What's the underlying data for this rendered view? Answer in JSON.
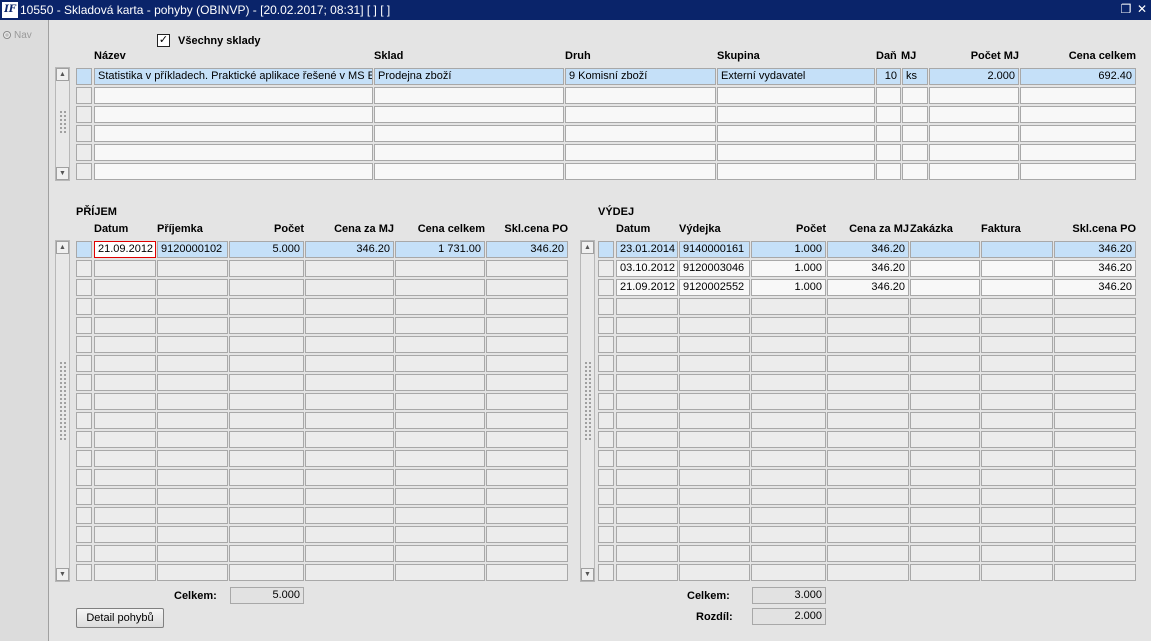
{
  "window": {
    "title": "10550 - Skladová karta - pohyby (OBINVP) - [20.02.2017; 08:31] [ ] [ ]",
    "icon_text": "IF",
    "restore_icon": "restore-icon",
    "close_icon": "close-icon"
  },
  "nav": {
    "label": "Nav"
  },
  "all_warehouses": {
    "label": "Všechny sklady",
    "checked": true
  },
  "items_table": {
    "headers": [
      "Název",
      "Sklad",
      "Druh",
      "Skupina",
      "Daň",
      "MJ",
      "Počet MJ",
      "Cena celkem"
    ],
    "rows": [
      [
        "Statistika v příkladech. Praktické aplikace řešené v MS Ex",
        "Prodejna zboží",
        "9 Komisní zboží",
        "Externí vydavatel",
        "10",
        "ks",
        "2.000",
        "692.40"
      ],
      [
        "",
        "",
        "",
        "",
        "",
        "",
        "",
        ""
      ],
      [
        "",
        "",
        "",
        "",
        "",
        "",
        "",
        ""
      ],
      [
        "",
        "",
        "",
        "",
        "",
        "",
        "",
        ""
      ],
      [
        "",
        "",
        "",
        "",
        "",
        "",
        "",
        ""
      ],
      [
        "",
        "",
        "",
        "",
        "",
        "",
        "",
        ""
      ]
    ]
  },
  "receipts": {
    "title": "PŘÍJEM",
    "headers": [
      "Datum",
      "Příjemka",
      "Počet",
      "Cena za MJ",
      "Cena celkem",
      "Skl.cena PO"
    ],
    "rows": [
      [
        "21.09.2012",
        "9120000102",
        "5.000",
        "346.20",
        "1 731.00",
        "346.20"
      ]
    ],
    "total_label": "Celkem:",
    "total_value": "5.000",
    "detail_button": "Detail pohybů"
  },
  "issues": {
    "title": "VÝDEJ",
    "headers": [
      "Datum",
      "Výdejka",
      "Počet",
      "Cena za MJ",
      "Zakázka",
      "Faktura",
      "Skl.cena PO"
    ],
    "rows": [
      [
        "23.01.2014",
        "9140000161",
        "1.000",
        "346.20",
        "",
        "",
        "346.20"
      ],
      [
        "03.10.2012",
        "9120003046",
        "1.000",
        "346.20",
        "",
        "",
        "346.20"
      ],
      [
        "21.09.2012",
        "9120002552",
        "1.000",
        "346.20",
        "",
        "",
        "346.20"
      ]
    ],
    "total_label": "Celkem:",
    "total_value": "3.000",
    "diff_label": "Rozdíl:",
    "diff_value": "2.000"
  },
  "colors": {
    "titlebar": "#0a246a",
    "selected_row": "#c5e0f8",
    "focus_border": "#e00000"
  }
}
